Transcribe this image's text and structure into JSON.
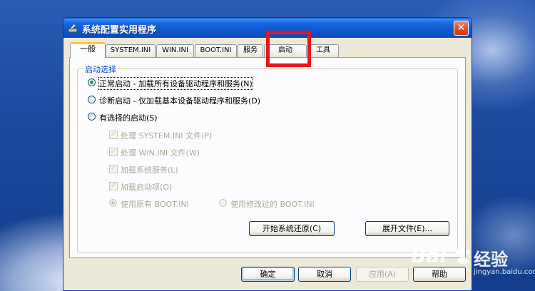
{
  "window": {
    "title": "系统配置实用程序",
    "close_glyph": "✕"
  },
  "tabs": [
    {
      "label": "一般",
      "active": true
    },
    {
      "label": "SYSTEM.INI"
    },
    {
      "label": "WIN.INI"
    },
    {
      "label": "BOOT.INI"
    },
    {
      "label": "服务"
    },
    {
      "label": "启动"
    },
    {
      "label": "工具"
    }
  ],
  "startup_group": {
    "title": "启动选择",
    "options": [
      {
        "label": "正常启动 - 加载所有设备驱动程序和服务(N)",
        "selected": true
      },
      {
        "label": "诊断启动 - 仅加载基本设备驱动程序和服务(D)",
        "selected": false
      },
      {
        "label": "有选择的启动(S)",
        "selected": false
      }
    ],
    "selective_items": [
      {
        "label": "处理 SYSTEM.INI 文件(P)",
        "checked": true
      },
      {
        "label": "处理 WIN.INI 文件(W)",
        "checked": true
      },
      {
        "label": "加载系统服务(L)",
        "checked": true
      },
      {
        "label": "加载启动项(O)",
        "checked": true
      }
    ],
    "boot_options": [
      {
        "label": "使用原有 BOOT.INI",
        "selected": true
      },
      {
        "label": "使用修改过的 BOOT.INI",
        "selected": false
      }
    ],
    "restore_button": "开始系统还原(C)",
    "expand_button": "展开文件(E)..."
  },
  "footer_buttons": {
    "ok": "确定",
    "cancel": "取消",
    "apply": "应用(A)",
    "help": "帮助"
  },
  "watermark": {
    "logo": "Bai",
    "brand": "经验",
    "url": "jingyan.baidu.com"
  },
  "colors": {
    "highlight": "#e8161c",
    "group_title": "#0046d5",
    "titlebar": "#0a5fd8"
  }
}
